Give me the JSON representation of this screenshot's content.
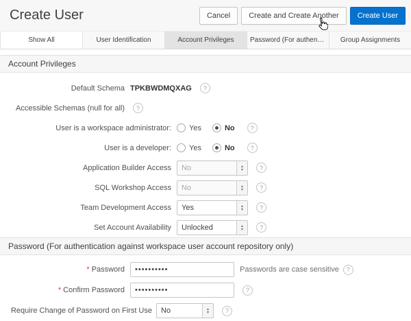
{
  "ui": {
    "help_glyph": "?",
    "required_marker": "*",
    "spin_up": "▴",
    "spin_down": "▾",
    "colors": {
      "primary_button": "#0572ce",
      "highlight_tab": "#e3e3e3"
    }
  },
  "header": {
    "title": "Create User",
    "buttons": [
      {
        "label": "Cancel"
      },
      {
        "label": "Create and Create Another"
      },
      {
        "label": "Create User"
      }
    ]
  },
  "tabs": [
    {
      "label": "Show All",
      "active": true
    },
    {
      "label": "User Identification",
      "active": false
    },
    {
      "label": "Account Privileges",
      "active": false
    },
    {
      "label": "Password (For authenticatio...",
      "active": false
    },
    {
      "label": "Group Assignments",
      "active": false
    }
  ],
  "sections": {
    "account_privileges": {
      "title": "Account Privileges",
      "fields": {
        "default_schema": {
          "label": "Default Schema",
          "value": "TPKBWDMQXAG"
        },
        "accessible_schemas": {
          "label": "Accessible Schemas (null for all)"
        },
        "workspace_admin": {
          "label": "User is a workspace administrator:",
          "options": [
            "Yes",
            "No"
          ],
          "selected": "No"
        },
        "developer": {
          "label": "User is a developer:",
          "options": [
            "Yes",
            "No"
          ],
          "selected": "No"
        },
        "app_builder_access": {
          "label": "Application Builder Access",
          "value": "No",
          "disabled": true
        },
        "sql_workshop_access": {
          "label": "SQL Workshop Access",
          "value": "No",
          "disabled": true
        },
        "team_dev_access": {
          "label": "Team Development Access",
          "value": "Yes",
          "disabled": false
        },
        "account_availability": {
          "label": "Set Account Availability",
          "value": "Unlocked",
          "disabled": false
        }
      }
    },
    "password": {
      "title": "Password (For authentication against workspace user account repository only)",
      "fields": {
        "password": {
          "label": "Password",
          "required": true,
          "value": "••••••••••",
          "note": "Passwords are case sensitive"
        },
        "confirm_password": {
          "label": "Confirm Password",
          "required": true,
          "value": "••••••••••"
        },
        "require_change": {
          "label": "Require Change of Password on First Use",
          "value": "No",
          "disabled": false
        }
      }
    }
  }
}
